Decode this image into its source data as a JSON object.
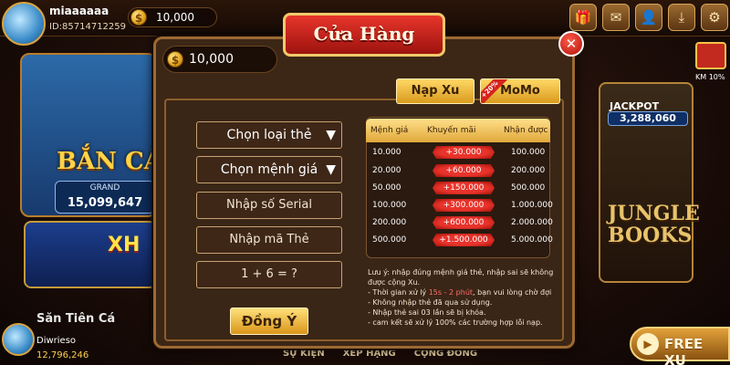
{
  "player": {
    "name": "miaaaaaa",
    "id": "ID:85714712259",
    "coins": "10,000"
  },
  "top_icons": [
    "gift-icon",
    "mail-icon",
    "profile-icon",
    "download-icon",
    "gear-icon"
  ],
  "lobby": {
    "left_game": {
      "title": "BẮN CÁ",
      "grand_label": "GRAND",
      "grand_value": "15,099,647"
    },
    "left_game2": {
      "title": "XH"
    },
    "jackpot": {
      "label": "JACKPOT",
      "value": "3,288,060",
      "game_title": "JUNGLE BOOKS"
    },
    "km_label": "KM 10%",
    "section_title": "Săn Tiên Cá",
    "bottom_player": {
      "name": "Diwrieso",
      "score": "12,796,246"
    },
    "bottom_nav": [
      "SỰ KIỆN",
      "XẾP HẠNG",
      "CỘNG ĐỒNG"
    ],
    "free_xu": "FREE XU"
  },
  "shop": {
    "title": "Cửa Hàng",
    "balance": "10,000",
    "tabs": {
      "napxu": "Nạp Xu",
      "momo": "MoMo",
      "momo_ribbon": "+20%"
    },
    "fields": {
      "card_type": "Chọn loại thẻ",
      "denomination": "Chọn mệnh giá",
      "serial": "Nhập số Serial",
      "code": "Nhập mã Thẻ",
      "captcha": "1 + 6 = ?"
    },
    "confirm": "Đồng Ý",
    "table": {
      "headers": [
        "Mệnh giá",
        "Khuyến mãi",
        "Nhận được"
      ],
      "rows": [
        [
          "10.000",
          "+30.000",
          "100.000"
        ],
        [
          "20.000",
          "+60.000",
          "200.000"
        ],
        [
          "50.000",
          "+150.000",
          "500.000"
        ],
        [
          "100.000",
          "+300.000",
          "1.000.000"
        ],
        [
          "200.000",
          "+600.000",
          "2.000.000"
        ],
        [
          "500.000",
          "+1.500.000",
          "5.000.000"
        ]
      ]
    },
    "notes": {
      "line1": "Lưu ý: nhập đúng mệnh giá thẻ, nhập sai sẽ không được cộng Xu.",
      "line2_a": "- Thời gian xử lý ",
      "line2_b": "15s - 2 phút",
      "line2_c": ", bạn vui lòng chờ đợi",
      "line3": "- Không nhập thẻ đã qua sử dụng.",
      "line4": "- Nhập thẻ sai 03 lần sẽ bị khóa.",
      "line5": "- cam kết sẽ xử lý 100% các trường hợp lỗi nạp."
    }
  }
}
